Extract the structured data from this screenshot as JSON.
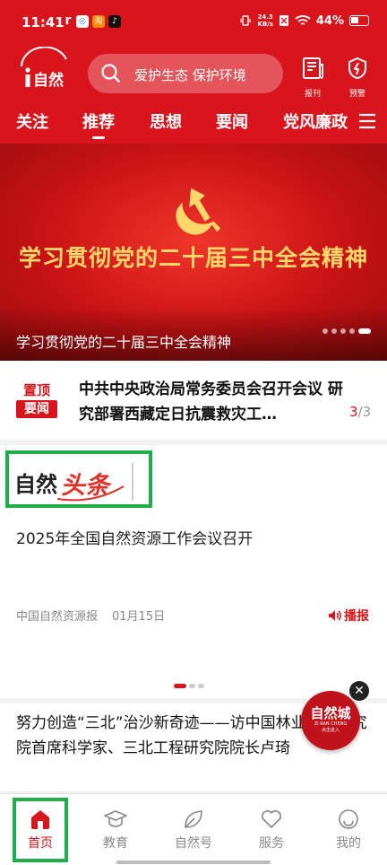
{
  "status_bar": {
    "time": "11:41",
    "net_speed_value": "24.3",
    "net_speed_unit": "KB/s",
    "battery": "44%"
  },
  "header": {
    "logo_text": "i自然",
    "search_placeholder": "爱护生态 保护环境",
    "newspaper_label": "报刊",
    "alert_label": "预警"
  },
  "tabs": [
    {
      "label": "关注",
      "active": false
    },
    {
      "label": "推荐",
      "active": true
    },
    {
      "label": "思想",
      "active": false
    },
    {
      "label": "要闻",
      "active": false
    },
    {
      "label": "党风廉政",
      "active": false
    }
  ],
  "banner": {
    "slogan": "学习贯彻党的二十届三中全会精神",
    "caption": "学习贯彻党的二十届三中全会精神",
    "dot_count": 5,
    "active_dot": 5
  },
  "pinned": {
    "badge_top": "置顶",
    "badge_bottom": "要闻",
    "title": "中共中央政治局常务委员会召开会议 研究部署西藏定日抗震救灾工…",
    "count_current": "3",
    "count_total": "/3"
  },
  "news_card": {
    "brand_text_1": "自然",
    "brand_text_2": "头条",
    "title": "2025年全国自然资源工作会议召开",
    "source": "中国自然资源报",
    "date": "01月15日",
    "broadcast_label": "播报"
  },
  "next_article": {
    "text": "努力创造“三北”治沙新奇迹——访中国林业科学研究院首席科学家、三北工程研究院院长卢琦"
  },
  "float_ad": {
    "title": "自然城",
    "subtitle": "ZI RAN CHENG",
    "tag": "点击进入"
  },
  "bottom_nav": [
    {
      "label": "首页",
      "icon": "home-icon",
      "active": true
    },
    {
      "label": "教育",
      "icon": "graduation-cap-icon",
      "active": false
    },
    {
      "label": "自然号",
      "icon": "leaf-icon",
      "active": false
    },
    {
      "label": "服务",
      "icon": "heart-icon",
      "active": false
    },
    {
      "label": "我的",
      "icon": "smile-icon",
      "active": false
    }
  ],
  "colors": {
    "brand_red": "#d8141c",
    "banner_gold": "#ffd76a",
    "highlight_green": "#1fae4b"
  }
}
